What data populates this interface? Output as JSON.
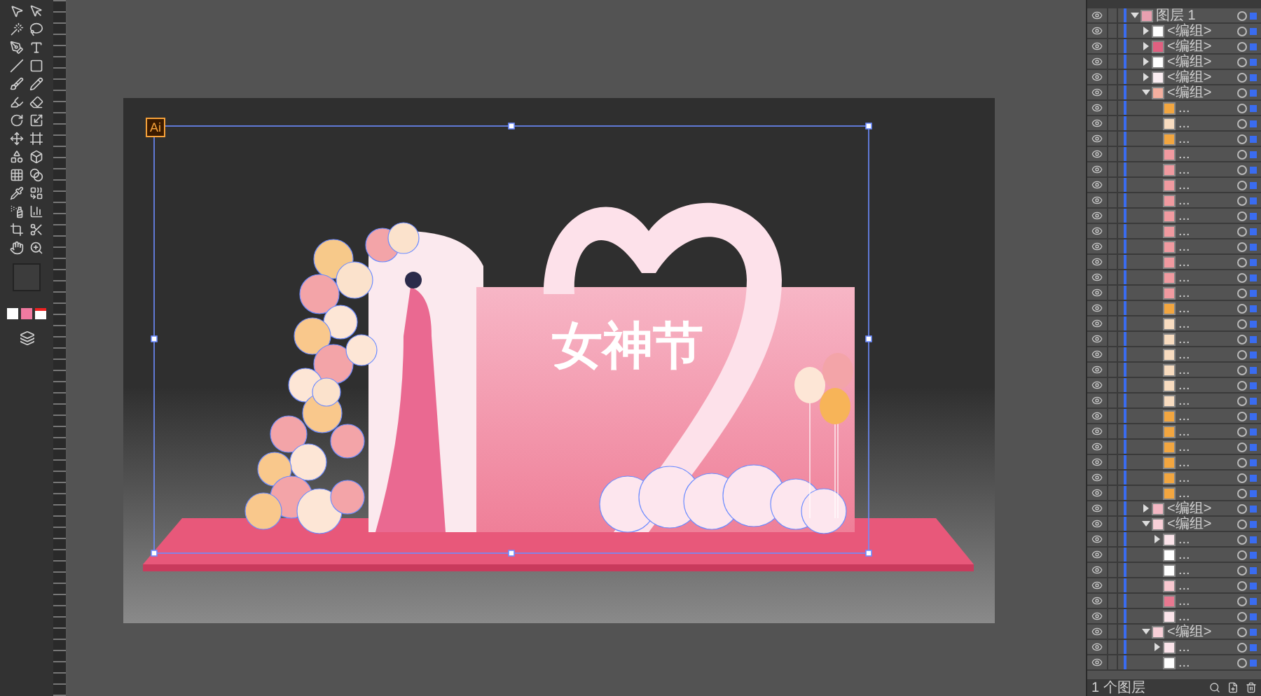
{
  "artwork": {
    "badge": "Ai",
    "title": "女神节"
  },
  "layers_panel": {
    "layers": [
      {
        "label": "图层 1",
        "expanded": true,
        "color": "#e8a0b0",
        "children": [
          {
            "label": "<编组>",
            "expanded": false,
            "color": "#ffffff"
          },
          {
            "label": "<编组>",
            "expanded": false,
            "color": "#e06080"
          },
          {
            "label": "<编组>",
            "expanded": false,
            "color": "#ffffff"
          },
          {
            "label": "<编组>",
            "expanded": false,
            "color": "#fbeef2"
          },
          {
            "label": "<编组>",
            "expanded": true,
            "color": "#f4b0a0",
            "children": [
              {
                "label": "...",
                "color": "#f2a640"
              },
              {
                "label": "...",
                "color": "#f8dcc0"
              },
              {
                "label": "...",
                "color": "#f2a640"
              },
              {
                "label": "...",
                "color": "#f09aa0"
              },
              {
                "label": "...",
                "color": "#f09aa0"
              },
              {
                "label": "...",
                "color": "#f09aa0"
              },
              {
                "label": "...",
                "color": "#f09aa0"
              },
              {
                "label": "...",
                "color": "#f09aa0"
              },
              {
                "label": "...",
                "color": "#f09aa0"
              },
              {
                "label": "...",
                "color": "#f09aa0"
              },
              {
                "label": "...",
                "color": "#f09aa0"
              },
              {
                "label": "...",
                "color": "#f09aa0"
              },
              {
                "label": "...",
                "color": "#f09aa0"
              },
              {
                "label": "...",
                "color": "#f2a640"
              },
              {
                "label": "...",
                "color": "#f8dcc0"
              },
              {
                "label": "...",
                "color": "#f8dcc0"
              },
              {
                "label": "...",
                "color": "#f8dcc0"
              },
              {
                "label": "...",
                "color": "#f8dcc0"
              },
              {
                "label": "...",
                "color": "#f8dcc0"
              },
              {
                "label": "...",
                "color": "#f8dcc0"
              },
              {
                "label": "...",
                "color": "#f2a640"
              },
              {
                "label": "...",
                "color": "#f2a640"
              },
              {
                "label": "...",
                "color": "#f2a640"
              },
              {
                "label": "...",
                "color": "#f2a640"
              },
              {
                "label": "...",
                "color": "#f2a640"
              },
              {
                "label": "...",
                "color": "#f2a640"
              }
            ]
          },
          {
            "label": "<编组>",
            "expanded": false,
            "color": "#f4b8c4"
          },
          {
            "label": "<编组>",
            "expanded": true,
            "color": "#f8d0d8",
            "children": [
              {
                "label": "...",
                "expanded": false,
                "color": "#fbe4ea"
              },
              {
                "label": "...",
                "color": "#ffffff"
              },
              {
                "label": "...",
                "color": "#ffffff"
              },
              {
                "label": "...",
                "color": "#f8c8d0"
              },
              {
                "label": "...",
                "color": "#e87890"
              },
              {
                "label": "...",
                "color": "#fbe4ea"
              }
            ]
          },
          {
            "label": "<编组>",
            "expanded": true,
            "color": "#f8d0d8",
            "children": [
              {
                "label": "...",
                "expanded": false,
                "color": "#fbe4ea"
              },
              {
                "label": "...",
                "color": "#ffffff"
              }
            ]
          }
        ]
      }
    ],
    "footer": "1 个图层"
  }
}
